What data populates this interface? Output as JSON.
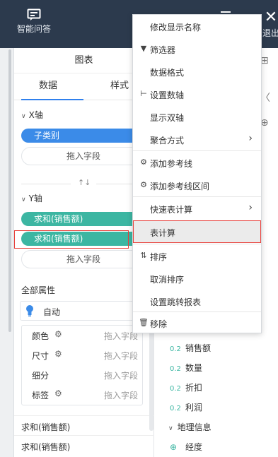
{
  "topbar": {
    "ai_label": "智能问答",
    "exit_label": "退出"
  },
  "panel": {
    "title": "图表",
    "tabs": {
      "data": "数据",
      "style": "样式"
    },
    "x_axis": {
      "header": "X轴",
      "field": "子类别",
      "drop": "拖入字段"
    },
    "y_axis": {
      "header": "Y轴",
      "fields": [
        "求和(销售额)",
        "求和(销售额)"
      ],
      "drop": "拖入字段"
    },
    "all_props": "全部属性",
    "auto": "自动",
    "attrs": [
      {
        "name": "颜色",
        "drop": "拖入字段"
      },
      {
        "name": "尺寸",
        "drop": "拖入字段"
      },
      {
        "name": "细分",
        "drop": "拖入字段"
      },
      {
        "name": "标签",
        "drop": "拖入字段"
      }
    ],
    "sums": [
      "求和(销售额)",
      "求和(销售额)"
    ]
  },
  "right": {
    "items": [
      {
        "tag": "0.2",
        "label": "销售额"
      },
      {
        "tag": "0.2",
        "label": "数量"
      },
      {
        "tag": "0.2",
        "label": "折扣"
      },
      {
        "tag": "0.2",
        "label": "利润"
      }
    ],
    "geo_header": "地理信息",
    "geo_item": "经度"
  },
  "menu": {
    "items": [
      {
        "label": "修改显示名称",
        "icon": ""
      },
      {
        "label": "筛选器",
        "icon": "filter-icon"
      },
      {
        "label": "数据格式",
        "icon": ""
      },
      {
        "label": "设置数轴",
        "icon": "axis-icon"
      },
      {
        "label": "显示双轴",
        "icon": ""
      },
      {
        "label": "聚合方式",
        "icon": "",
        "submenu": true
      },
      {
        "label": "添加参考线",
        "icon": "gear-icon"
      },
      {
        "label": "添加参考线区间",
        "icon": "gear-icon"
      },
      {
        "label": "快速表计算",
        "icon": "",
        "submenu": true
      },
      {
        "label": "表计算",
        "icon": "",
        "active": true
      },
      {
        "label": "排序",
        "icon": "sort-icon"
      },
      {
        "label": "取消排序",
        "icon": ""
      },
      {
        "label": "设置跳转报表",
        "icon": ""
      },
      {
        "label": "移除",
        "icon": "trash-icon"
      }
    ]
  },
  "colors": {
    "topbar": "#2c3a4d",
    "pill_blue": "#3b8be8",
    "pill_green": "#3cb6a2",
    "highlight": "#e8413c",
    "tab_accent": "#2f80ed"
  }
}
